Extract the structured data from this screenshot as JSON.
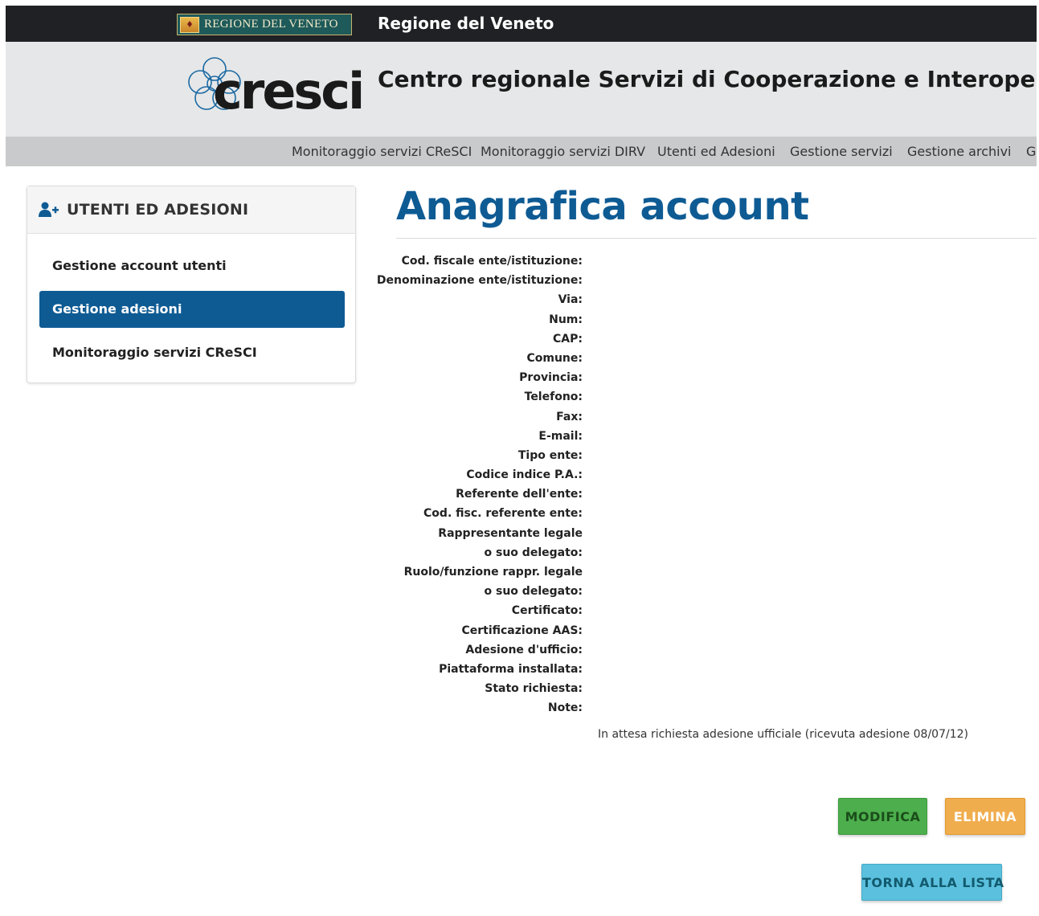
{
  "topbar": {
    "badge_text": "REGIONE DEL VENETO",
    "title": "Regione del Veneto"
  },
  "header": {
    "logo_text": "cresci",
    "title": "Centro regionale Servizi di Cooperazione e Interoperabilità"
  },
  "nav": {
    "items": [
      "Monitoraggio servizi CReSCI",
      "Monitoraggio servizi DIRV",
      "Utenti ed Adesioni",
      "Gestione servizi",
      "Gestione archivi",
      "Ge"
    ]
  },
  "sidebar": {
    "icon": "user-plus-icon",
    "title": "UTENTI ED ADESIONI",
    "items": [
      {
        "label": "Gestione account utenti",
        "active": false
      },
      {
        "label": "Gestione adesioni",
        "active": true
      },
      {
        "label": "Monitoraggio servizi CReSCI",
        "active": false
      }
    ]
  },
  "main": {
    "title": "Anagrafica account",
    "fields": [
      "Cod. fiscale ente/istituzione:",
      "Denominazione ente/istituzione:",
      "Via:",
      "Num:",
      "CAP:",
      "Comune:",
      "Provincia:",
      "Telefono:",
      "Fax:",
      "E-mail:",
      "Tipo ente:",
      "Codice indice P.A.:",
      "Referente dell'ente:",
      "Cod. fisc. referente ente:",
      "Rappresentante legale",
      "o suo delegato:",
      "Ruolo/funzione rappr. legale",
      "o suo delegato:",
      "Certificato:",
      "Certificazione AAS:",
      "Adesione d'ufficio:",
      "Piattaforma installata:",
      "Stato richiesta:",
      "Note:"
    ],
    "status_text": "In attesa richiesta adesione ufficiale (ricevuta adesione 08/07/12)"
  },
  "buttons": {
    "modify": "MODIFICA",
    "delete": "ELIMINA",
    "back": "TORNA ALLA LISTA"
  },
  "colors": {
    "brand_blue": "#0e5b94",
    "topbar": "#1f2125",
    "header_bg": "#e6e7e8",
    "nav_bg": "#c9cacc",
    "success": "#4cae4c",
    "warning": "#f0ad4e",
    "info": "#5bc0de"
  }
}
